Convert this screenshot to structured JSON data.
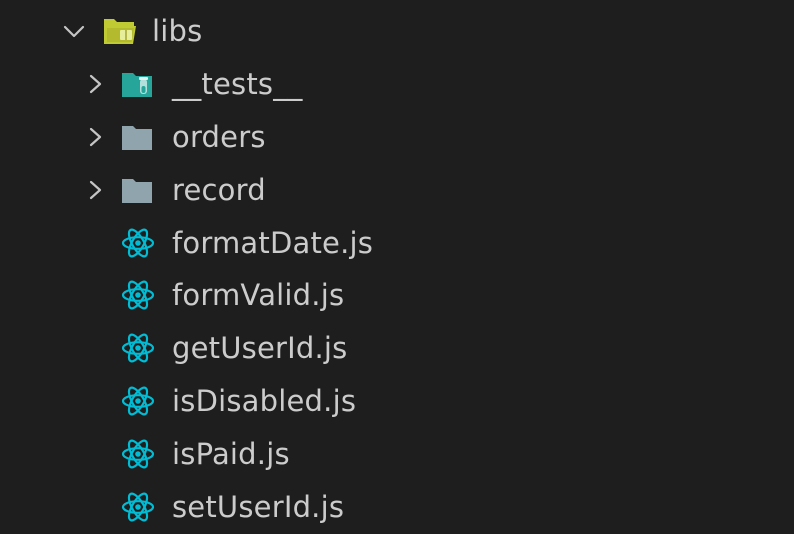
{
  "explorer": {
    "root": {
      "label": "libs",
      "icon": "folder-open-lib-icon",
      "expanded": true
    },
    "folders": [
      {
        "label": "__tests__",
        "icon": "folder-test-icon",
        "expanded": false
      },
      {
        "label": "orders",
        "icon": "folder-icon",
        "expanded": false
      },
      {
        "label": "record",
        "icon": "folder-icon",
        "expanded": false
      }
    ],
    "files": [
      {
        "label": "formatDate.js",
        "icon": "react-icon"
      },
      {
        "label": "formValid.js",
        "icon": "react-icon"
      },
      {
        "label": "getUserId.js",
        "icon": "react-icon"
      },
      {
        "label": "isDisabled.js",
        "icon": "react-icon"
      },
      {
        "label": "isPaid.js",
        "icon": "react-icon"
      },
      {
        "label": "setUserId.js",
        "icon": "react-icon"
      }
    ]
  },
  "colors": {
    "background": "#1e1e1e",
    "text": "#cccccc",
    "chevron": "#c5c5c5",
    "lib_folder": "#c0ca33",
    "test_folder": "#26a69a",
    "plain_folder": "#90a4ae",
    "react": "#00bcd4"
  }
}
